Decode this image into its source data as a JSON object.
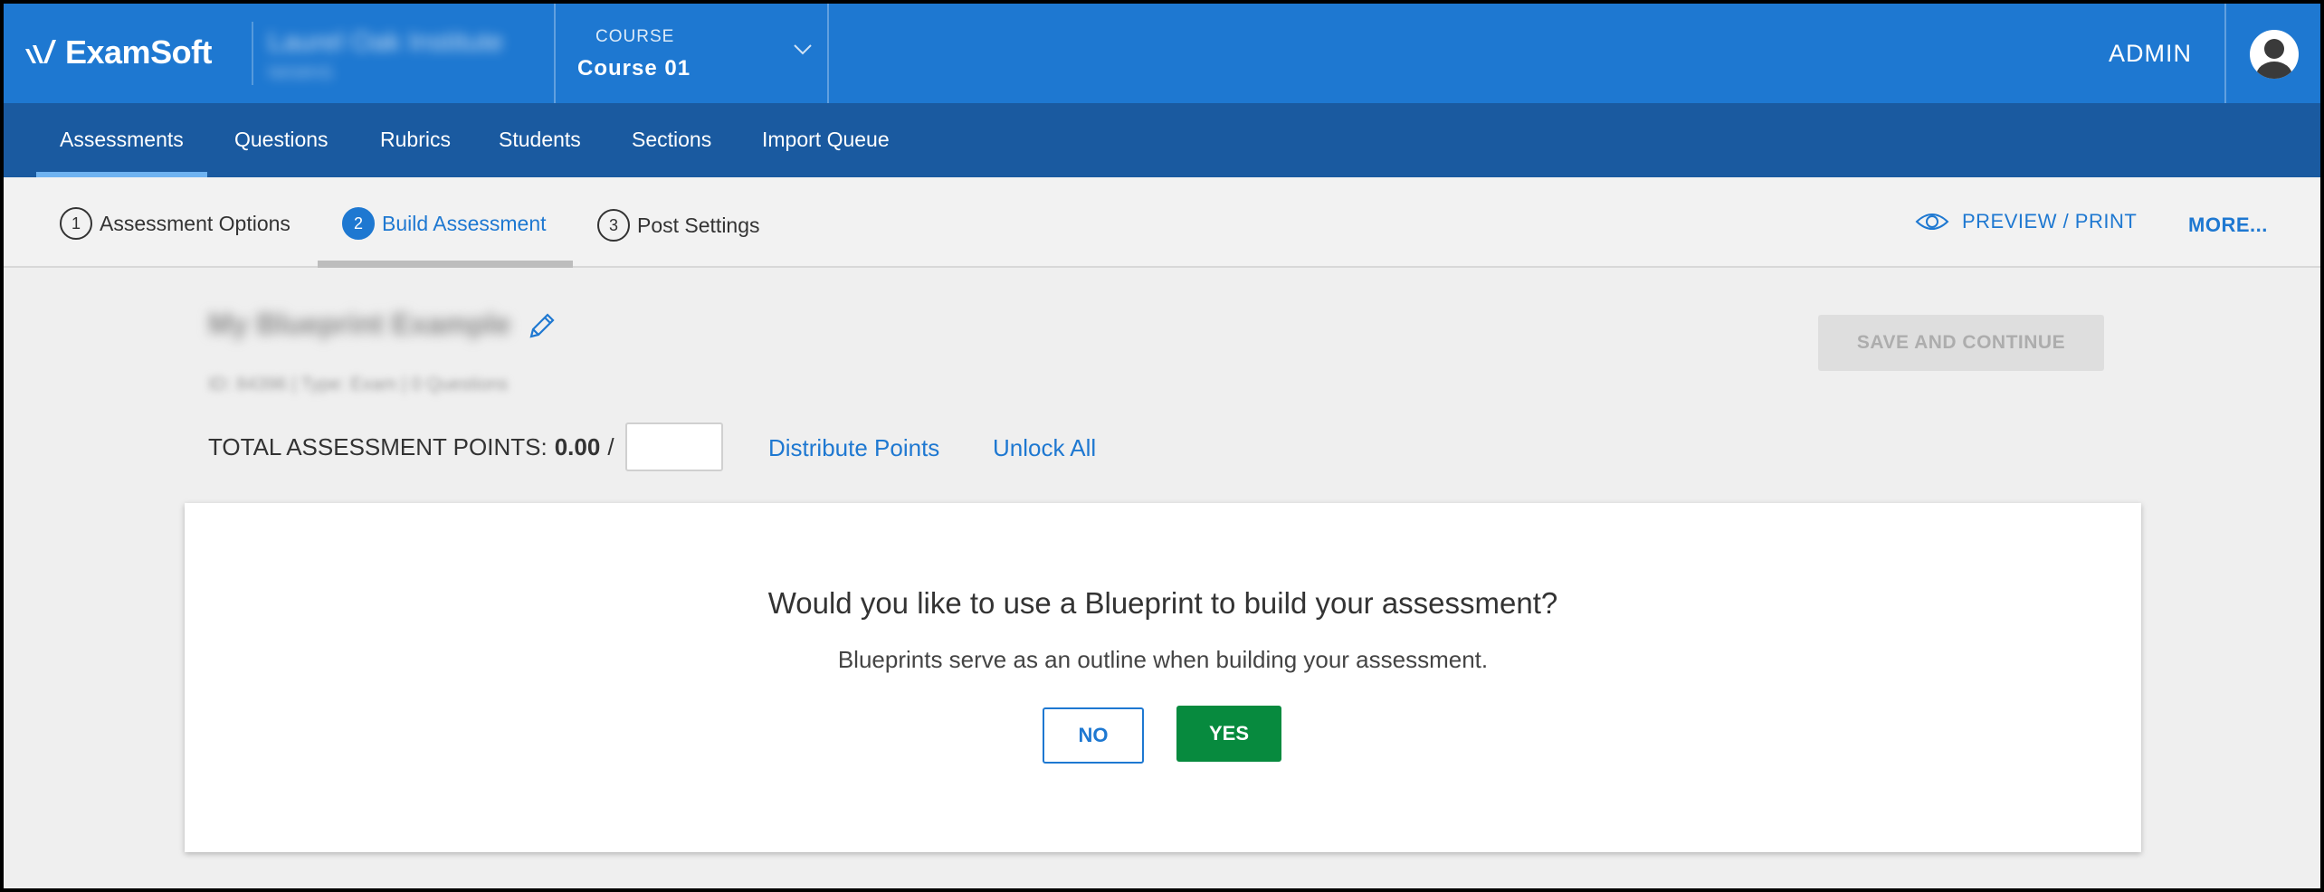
{
  "header": {
    "logo_text": "ExamSoft",
    "institution_name": "Laurel Oak Institute",
    "institution_sub": "NKMHS",
    "course_label": "COURSE",
    "course_name": "Course 01",
    "admin_label": "ADMIN"
  },
  "main_nav": {
    "tabs": [
      {
        "label": "Assessments",
        "active": true
      },
      {
        "label": "Questions"
      },
      {
        "label": "Rubrics"
      },
      {
        "label": "Students"
      },
      {
        "label": "Sections"
      },
      {
        "label": "Import Queue"
      }
    ]
  },
  "steps": {
    "items": [
      {
        "num": "1",
        "label": "Assessment Options"
      },
      {
        "num": "2",
        "label": "Build Assessment",
        "active": true
      },
      {
        "num": "3",
        "label": "Post Settings"
      }
    ],
    "preview_label": "PREVIEW / PRINT",
    "more_label": "MORE..."
  },
  "assessment": {
    "title": "My Blueprint Example",
    "subtitle": "ID: 84396 | Type: Exam | 0 Questions",
    "save_label": "SAVE AND CONTINUE",
    "points_label": "TOTAL ASSESSMENT POINTS:",
    "points_value": "0.00",
    "points_slash": "/",
    "points_total": "",
    "distribute_label": "Distribute Points",
    "unlock_label": "Unlock All"
  },
  "blueprint_prompt": {
    "question": "Would you like to use a Blueprint to build your assessment?",
    "description": "Blueprints serve as an outline when building your assessment.",
    "no_label": "NO",
    "yes_label": "YES"
  },
  "colors": {
    "header_blue": "#1e78d1",
    "nav_blue": "#1a5aa0",
    "yes_green": "#078a3e"
  }
}
